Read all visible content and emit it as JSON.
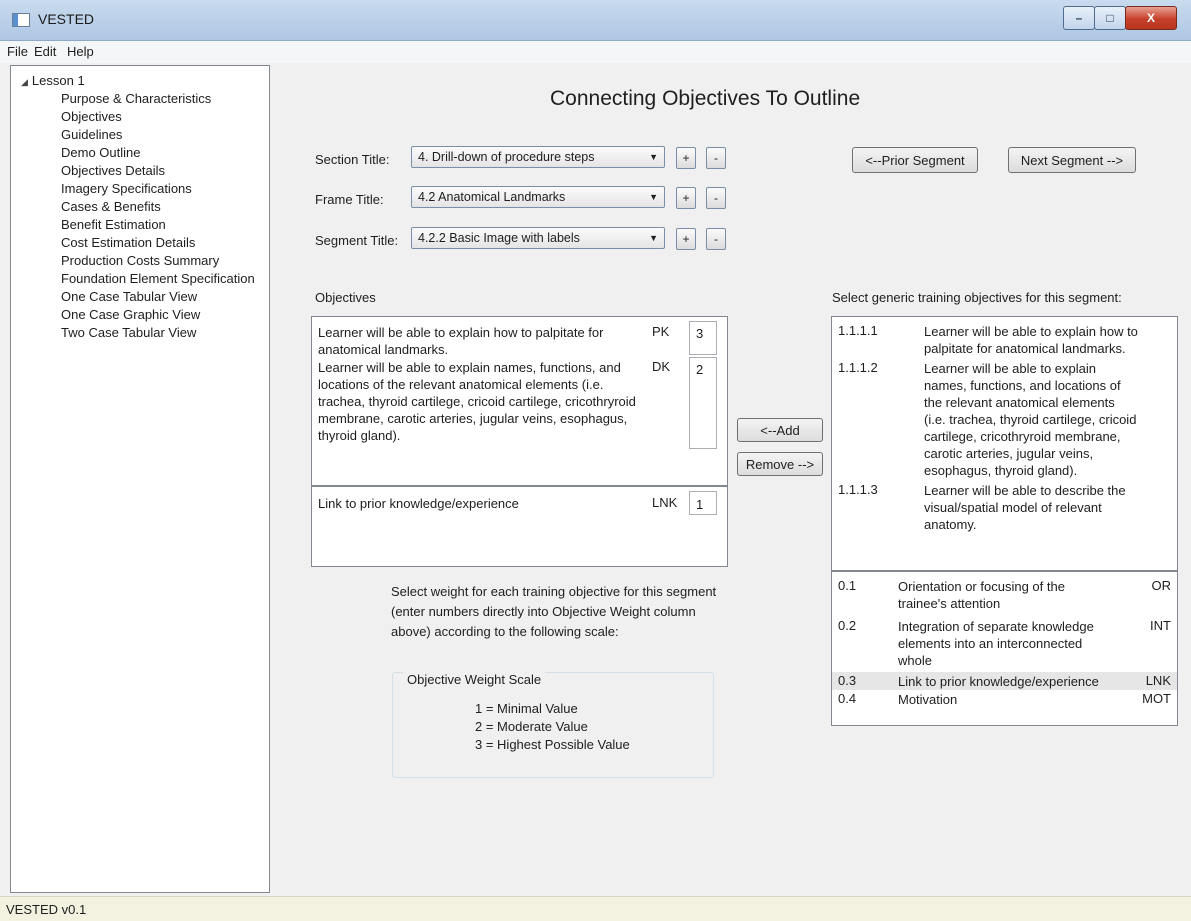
{
  "window": {
    "title": "VESTED",
    "min": "–",
    "max": "□",
    "close": "X"
  },
  "menu": [
    "File",
    "Edit",
    "Help"
  ],
  "tree": {
    "root": "Lesson 1",
    "items": [
      "Purpose & Characteristics",
      "Objectives",
      "Guidelines",
      "Demo Outline",
      "Objectives Details",
      "Imagery Specifications",
      "Cases & Benefits",
      "Benefit Estimation",
      "Cost Estimation Details",
      "Production Costs Summary",
      "Foundation Element Specification",
      "One Case Tabular View",
      "One Case Graphic View",
      "Two Case Tabular View"
    ]
  },
  "main": {
    "title": "Connecting Objectives To Outline",
    "section_label": "Section Title:",
    "section_value": "4. Drill-down of procedure steps",
    "frame_label": "Frame Title:",
    "frame_value": "4.2 Anatomical Landmarks",
    "segment_label": "Segment Title:",
    "segment_value": "4.2.2 Basic Image with labels",
    "plus": "+",
    "minus": "-",
    "prior_segment": "<--Prior Segment",
    "next_segment": "Next Segment -->",
    "objectives_label": "Objectives",
    "generic_label": "Select generic training objectives for this segment:",
    "add": "<--Add",
    "remove": "Remove -->",
    "objectives": [
      {
        "text": "Learner will be able to explain how to palpitate for anatomical landmarks.",
        "code": "PK",
        "weight": "3"
      },
      {
        "text": "Learner will be able to explain names, functions, and locations of the relevant anatomical elements (i.e. trachea, thyroid cartilege, cricoid cartilege, cricothryroid membrane, carotic arteries, jugular veins, esophagus, thyroid gland).",
        "code": "DK",
        "weight": "2"
      }
    ],
    "link_objective": {
      "text": "Link to prior knowledge/experience",
      "code": "LNK",
      "weight": "1"
    },
    "generic_objectives": [
      {
        "num": "1.1.1.1",
        "text": "Learner will be able to explain how to palpitate for anatomical landmarks."
      },
      {
        "num": "1.1.1.2",
        "text": "Learner will be able to explain names, functions, and locations of the relevant anatomical elements (i.e. trachea, thyroid cartilege, cricoid cartilege, cricothryroid membrane, carotic arteries, jugular veins, esophagus, thyroid gland)."
      },
      {
        "num": "1.1.1.3",
        "text": "Learner will be able to describe the visual/spatial model of relevant anatomy."
      }
    ],
    "categories": [
      {
        "num": "0.1",
        "text": "Orientation or focusing of the trainee's attention",
        "code": "OR"
      },
      {
        "num": "0.2",
        "text": "Integration of separate knowledge elements into an interconnected whole",
        "code": "INT"
      },
      {
        "num": "0.3",
        "text": "Link to prior knowledge/experience",
        "code": "LNK"
      },
      {
        "num": "0.4",
        "text": "Motivation",
        "code": "MOT"
      }
    ],
    "weight_instructions": "Select weight for each training objective for this segment (enter numbers directly into Objective Weight column above) according to the following scale:",
    "scale_title": "Objective Weight Scale",
    "scale": [
      "1 = Minimal Value",
      "2 = Moderate Value",
      "3 = Highest Possible Value"
    ]
  },
  "status": "VESTED v0.1",
  "colors": {
    "selected_row": "#e6e6e6",
    "statusbar": "#f3f1df"
  }
}
